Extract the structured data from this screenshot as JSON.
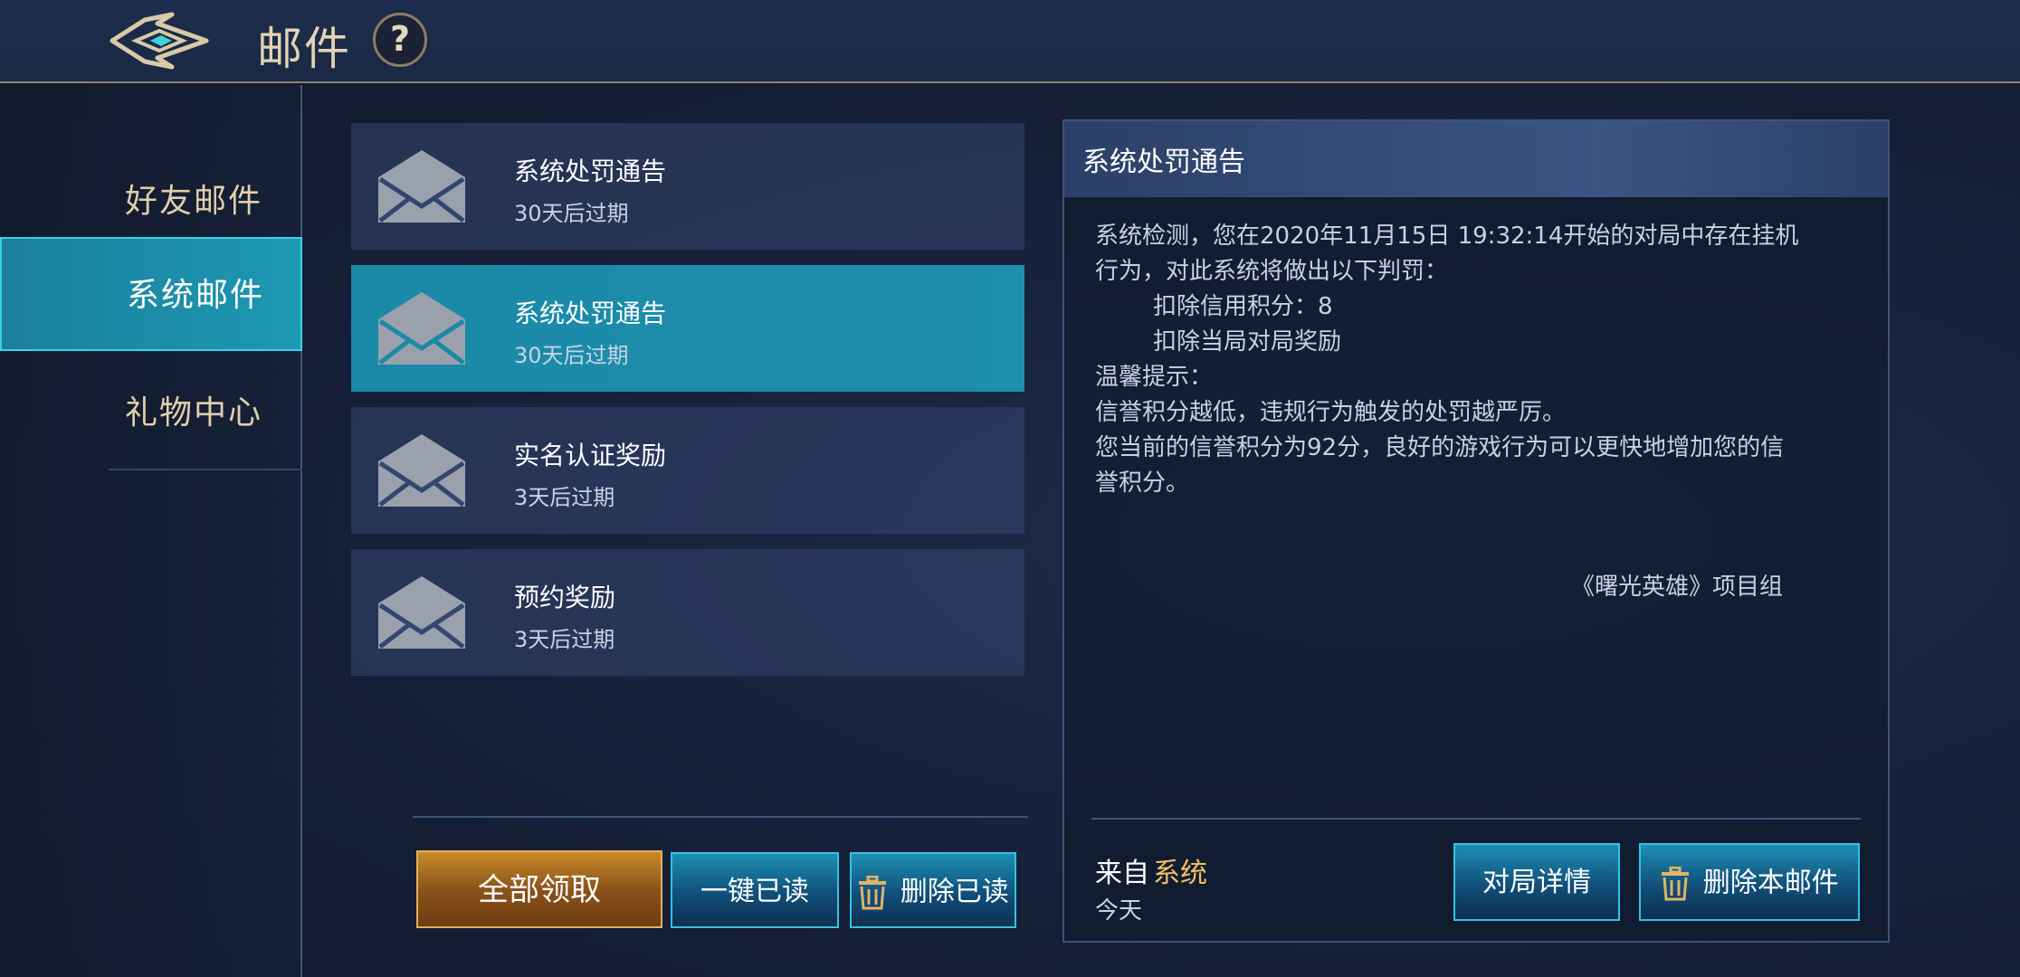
{
  "header": {
    "logo_icon": "diamond-wing-logo-icon",
    "title": "邮件",
    "help_label": "?"
  },
  "sidebar": {
    "items": [
      {
        "label": "好友邮件",
        "active": false
      },
      {
        "label": "系统邮件",
        "active": true
      },
      {
        "label": "礼物中心",
        "active": false
      }
    ]
  },
  "mail_list": {
    "items": [
      {
        "title": "系统处罚通告",
        "expire": "30天后过期",
        "selected": false,
        "icon": "envelope-icon"
      },
      {
        "title": "系统处罚通告",
        "expire": "30天后过期",
        "selected": true,
        "icon": "envelope-icon"
      },
      {
        "title": "实名认证奖励",
        "expire": "3天后过期",
        "selected": false,
        "icon": "envelope-icon"
      },
      {
        "title": "预约奖励",
        "expire": "3天后过期",
        "selected": false,
        "icon": "envelope-icon"
      }
    ],
    "buttons": {
      "claim_all": "全部领取",
      "mark_all_read": "一键已读",
      "delete_read": "删除已读"
    }
  },
  "detail": {
    "title": "系统处罚通告",
    "body": {
      "line1": "系统检测，您在2020年11月15日 19:32:14开始的对局中存在挂机",
      "line2": "行为，对此系统将做出以下判罚：",
      "line3": "扣除信用积分：8",
      "line4": "扣除当局对局奖励",
      "line5": "温馨提示：",
      "line6": "信誉积分越低，违规行为触发的处罚越严厉。",
      "line7": "您当前的信誉积分为92分，良好的游戏行为可以更快地增加您的信",
      "line8": "誉积分。"
    },
    "signature": "《曙光英雄》项目组",
    "from_label": "来自",
    "from_value": "系统",
    "date": "今天",
    "buttons": {
      "match_detail": "对局详情",
      "delete_mail": "删除本邮件"
    }
  },
  "colors": {
    "accent_cyan": "#1d98b3",
    "gold": "#f0c060",
    "panel_bg": "#1a2945"
  }
}
